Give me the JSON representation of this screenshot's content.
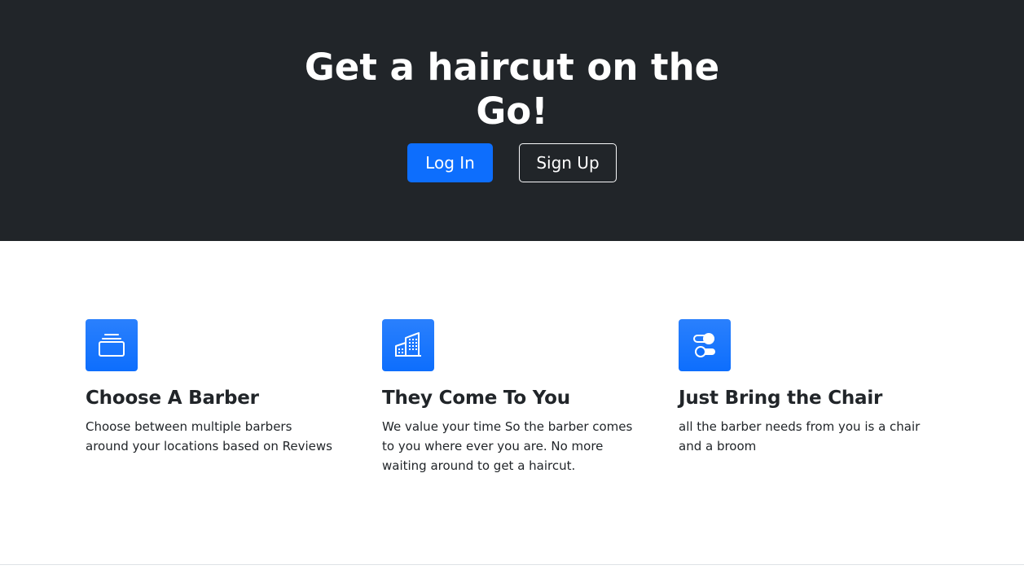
{
  "hero": {
    "title_line1": "Get a haircut on the",
    "title_line2": "Go!",
    "login_label": "Log In",
    "signup_label": "Sign Up"
  },
  "features": [
    {
      "icon": "collection-icon",
      "title": "Choose A Barber",
      "text": "Choose between multiple barbers around your locations based on Reviews"
    },
    {
      "icon": "building-icon",
      "title": "They Come To You",
      "text": "We value your time So the barber comes to you where ever you are. No more waiting around to get a haircut."
    },
    {
      "icon": "toggles-icon",
      "title": "Just Bring the Chair",
      "text": "all the barber needs from you is a chair and a broom"
    }
  ],
  "colors": {
    "hero_bg": "#212529",
    "primary": "#0d6efd",
    "text": "#212529",
    "divider": "#dee2e6"
  }
}
